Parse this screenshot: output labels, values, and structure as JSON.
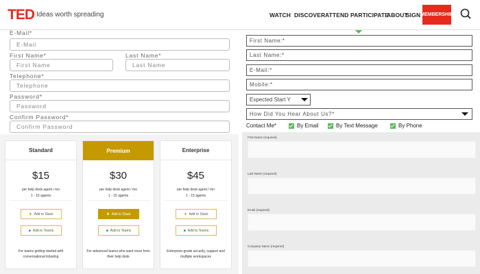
{
  "header": {
    "logo": "TED",
    "tagline": "Ideas worth spreading",
    "nav": [
      "WATCH",
      "DISCOVER",
      "ATTEND",
      "PARTICIPATE",
      "ABOUT",
      "SIGN IN"
    ],
    "membership": "MEMBERSHIP",
    "accent_color": "#e62b1e"
  },
  "left_form": {
    "email_label": "E-Mail*",
    "email_placeholder": "E-Mail",
    "first_label": "First Name*",
    "first_placeholder": "First Name",
    "last_label": "Last Name*",
    "last_placeholder": "Last Name",
    "phone_label": "Telephone*",
    "phone_placeholder": "Telephone",
    "password_label": "Password*",
    "password_placeholder": "Password",
    "confirm_label": "Confirm Password*",
    "confirm_placeholder": "Confirm Password"
  },
  "pricing": {
    "accent_color": "#c49a00",
    "plans": [
      {
        "name": "Standard",
        "price": "$15",
        "desc1": "per help desk agent / mo",
        "desc2": "1 - 15 agents",
        "slack": "Add to Slack",
        "teams": "Add to Teams",
        "footer": "For teams getting started with conversational ticketing"
      },
      {
        "name": "Premium",
        "price": "$30",
        "desc1": "per help desk agent / mo",
        "desc2": "1 - 15 agents",
        "slack": "Add to Slack",
        "teams": "Add to Teams",
        "footer": "For advanced teams who want more from their help desk"
      },
      {
        "name": "Enterprise",
        "price": "$45",
        "desc1": "per help desk agent / mo",
        "desc2": "1 - 15 agents",
        "slack": "Add to Slack",
        "teams": "Add to Teams",
        "footer": "Enterprise-grade security, support and multiple workspaces"
      }
    ]
  },
  "right_form": {
    "first_placeholder": "First Name:*",
    "last_placeholder": "Last Name:*",
    "email_placeholder": "E-Mail:*",
    "mobile_placeholder": "Mobile:*",
    "start_select": "Expected Start Y",
    "hear_select": "How Did You Hear About Us?*",
    "contact_label": "Contact Me*",
    "by_email": "By Email",
    "by_text": "By Text Message",
    "by_phone": "By Phone",
    "check_color": "#5cb85c"
  },
  "gray_form": {
    "first_label": "First Name (required)",
    "last_label": "Last Name (required)",
    "email_label": "Email (required)",
    "company_label": "Company Name (required)"
  }
}
